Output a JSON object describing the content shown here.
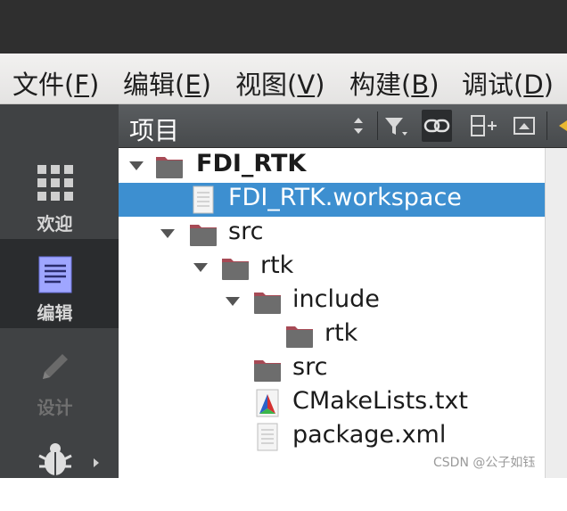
{
  "menubar": {
    "items": [
      {
        "label": "文件(",
        "accel": "F",
        "tail": ")"
      },
      {
        "label": "编辑(",
        "accel": "E",
        "tail": ")"
      },
      {
        "label": "视图(",
        "accel": "V",
        "tail": ")"
      },
      {
        "label": "构建(",
        "accel": "B",
        "tail": ")"
      },
      {
        "label": "调试(",
        "accel": "D",
        "tail": ")"
      }
    ]
  },
  "modebar": {
    "modes": [
      {
        "label": "欢迎",
        "icon": "grid-icon",
        "state": "normal"
      },
      {
        "label": "编辑",
        "icon": "document-icon",
        "state": "active"
      },
      {
        "label": "设计",
        "icon": "pencil-icon",
        "state": "disabled"
      },
      {
        "label": "",
        "icon": "bug-icon",
        "state": "normal"
      }
    ]
  },
  "project_panel": {
    "title": "项目",
    "tools": [
      "sort-updown-icon",
      "filter-icon",
      "link-icon",
      "split-icon",
      "collapse-icon"
    ]
  },
  "tree": {
    "items": [
      {
        "label": "FDI_RTK",
        "type": "project-folder",
        "expanded": true,
        "bold": true
      },
      {
        "label": "FDI_RTK.workspace",
        "type": "file",
        "selected": true
      },
      {
        "label": "src",
        "type": "folder",
        "expanded": true
      },
      {
        "label": "rtk",
        "type": "folder",
        "expanded": true
      },
      {
        "label": "include",
        "type": "folder",
        "expanded": true
      },
      {
        "label": "rtk",
        "type": "folder"
      },
      {
        "label": "src",
        "type": "folder"
      },
      {
        "label": "CMakeLists.txt",
        "type": "cmake-file"
      },
      {
        "label": "package.xml",
        "type": "file"
      }
    ]
  },
  "watermark": "CSDN @公子如钰",
  "colors": {
    "selection": "#3d8fd0",
    "folder": "#6d6d6d",
    "folder_tab": "#a64a55",
    "modebar": "#404244"
  }
}
